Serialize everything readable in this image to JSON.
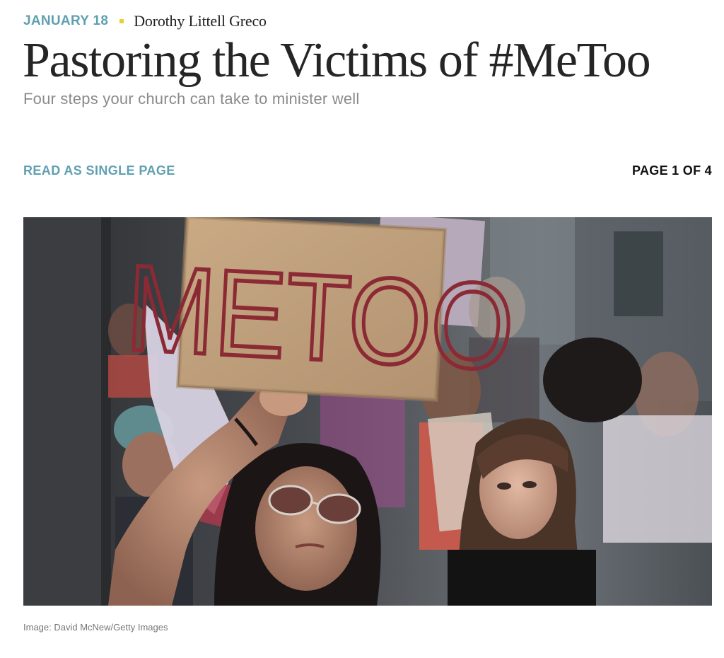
{
  "article": {
    "date": "JANUARY 18",
    "author": "Dorothy Littell Greco",
    "title": "Pastoring the Victims of #MeToo",
    "subtitle": "Four steps your church can take to minister well"
  },
  "pagination": {
    "single_page_label": "READ AS SINGLE PAGE",
    "page_indicator": "PAGE 1 OF 4"
  },
  "image": {
    "sign_text": "METOO",
    "credit": "Image: David McNew/Getty Images"
  },
  "colors": {
    "accent": "#5fa0b0",
    "separator": "#e8cf3a",
    "headline": "#252525",
    "dek": "#8a8a8a",
    "sign_ink": "#8b2a35",
    "cardboard": "#c2a27c"
  }
}
